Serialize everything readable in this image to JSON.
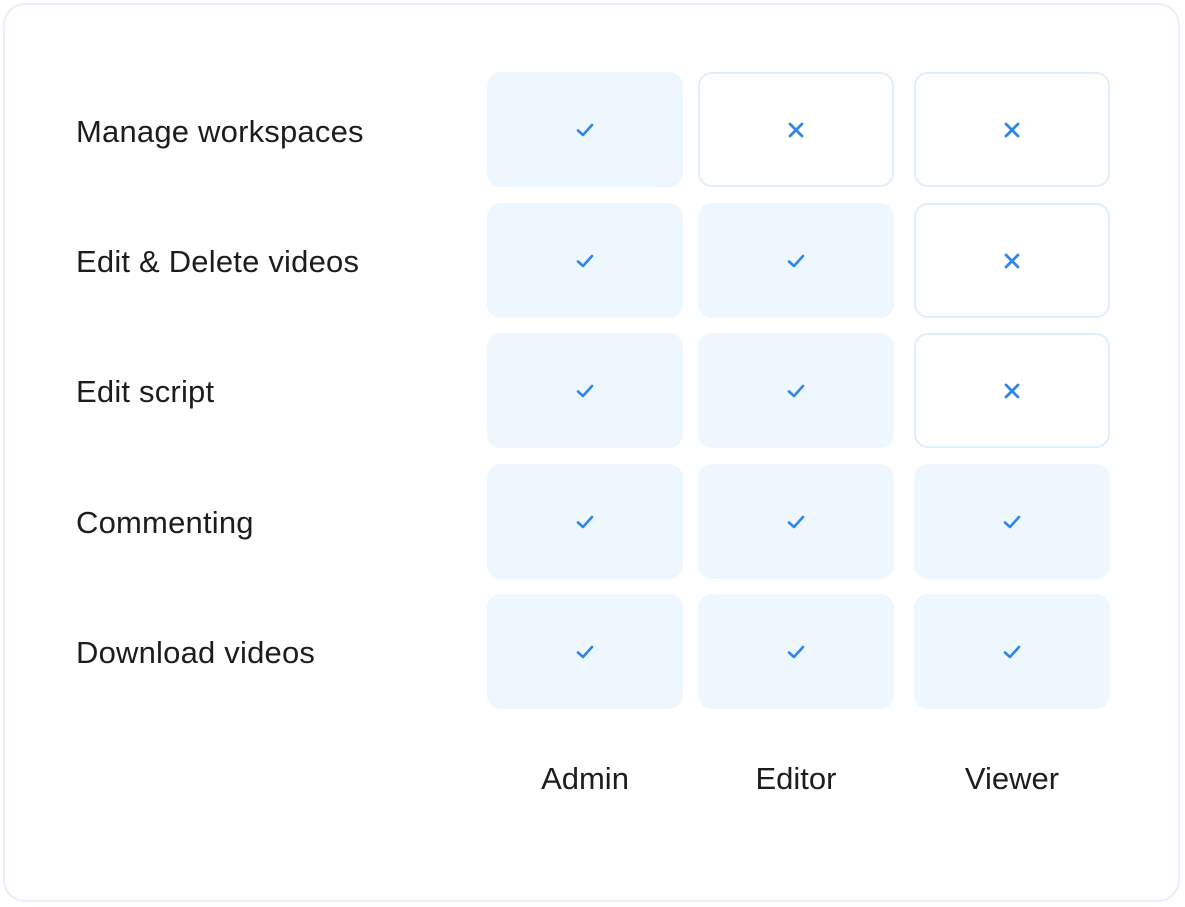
{
  "colors": {
    "accent": "#2e86ea",
    "allowed_bg": "#eef6fe",
    "denied_border": "#e3eefb",
    "text": "#1d1d1f"
  },
  "columns": [
    "Admin",
    "Editor",
    "Viewer"
  ],
  "rows": [
    {
      "label": "Manage workspaces",
      "permissions": [
        "check",
        "cross",
        "cross"
      ]
    },
    {
      "label": "Edit & Delete videos",
      "permissions": [
        "check",
        "check",
        "cross"
      ]
    },
    {
      "label": "Edit script",
      "permissions": [
        "check",
        "check",
        "cross"
      ]
    },
    {
      "label": "Commenting",
      "permissions": [
        "check",
        "check",
        "check"
      ]
    },
    {
      "label": "Download videos",
      "permissions": [
        "check",
        "check",
        "check"
      ]
    }
  ]
}
